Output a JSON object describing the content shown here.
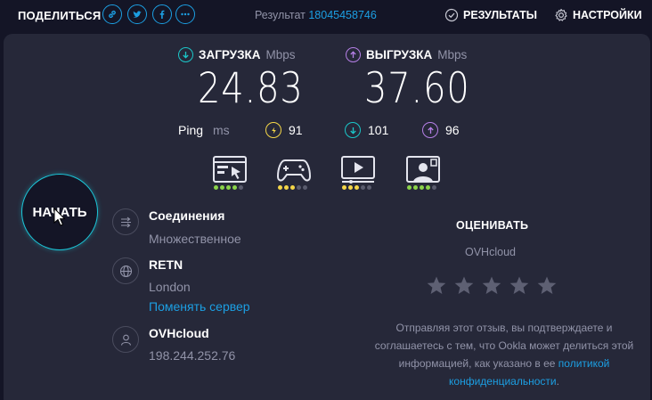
{
  "topbar": {
    "share_label": "ПОДЕЛИТЬСЯ",
    "share_buttons": [
      "link-icon",
      "twitter-icon",
      "facebook-icon",
      "more-icon"
    ],
    "result_label": "Результат",
    "result_id": "18045458746",
    "results_label": "РЕЗУЛЬТАТЫ",
    "settings_label": "НАСТРОЙКИ"
  },
  "download": {
    "label": "ЗАГРУЗКА",
    "unit": "Mbps",
    "value": "24.83",
    "color": "#1bc6c8"
  },
  "upload": {
    "label": "ВЫГРУЗКА",
    "unit": "Mbps",
    "value": "37.60",
    "color": "#b57fe6"
  },
  "ping": {
    "label": "Ping",
    "unit": "ms",
    "idle": "91",
    "download": "101",
    "upload": "96",
    "colors": {
      "idle": "#f4d648",
      "download": "#1bc6c8",
      "upload": "#b57fe6"
    }
  },
  "app_ratings": [
    {
      "icon": "web-browsing-icon",
      "level": 4
    },
    {
      "icon": "gaming-icon",
      "level": 3
    },
    {
      "icon": "video-streaming-icon",
      "level": 3
    },
    {
      "icon": "video-call-icon",
      "level": 4
    }
  ],
  "start_button": {
    "label": "НАЧАТЬ"
  },
  "info": {
    "connections": {
      "title": "Соединения",
      "value": "Множественное"
    },
    "server": {
      "title": "RETN",
      "location": "London",
      "change_link": "Поменять сервер"
    },
    "provider": {
      "title": "OVHcloud",
      "ip": "198.244.252.76"
    }
  },
  "rating": {
    "title": "ОЦЕНИВАТЬ",
    "provider": "OVHcloud",
    "stars": 5,
    "disclaimer_part1": "Отправляя этот отзыв, вы подтверждаете и соглашаетесь с тем, что Ookla может делиться этой информацией, как указано в ее",
    "disclaimer_link": "политикой конфиденциальности",
    "disclaimer_end": "."
  }
}
